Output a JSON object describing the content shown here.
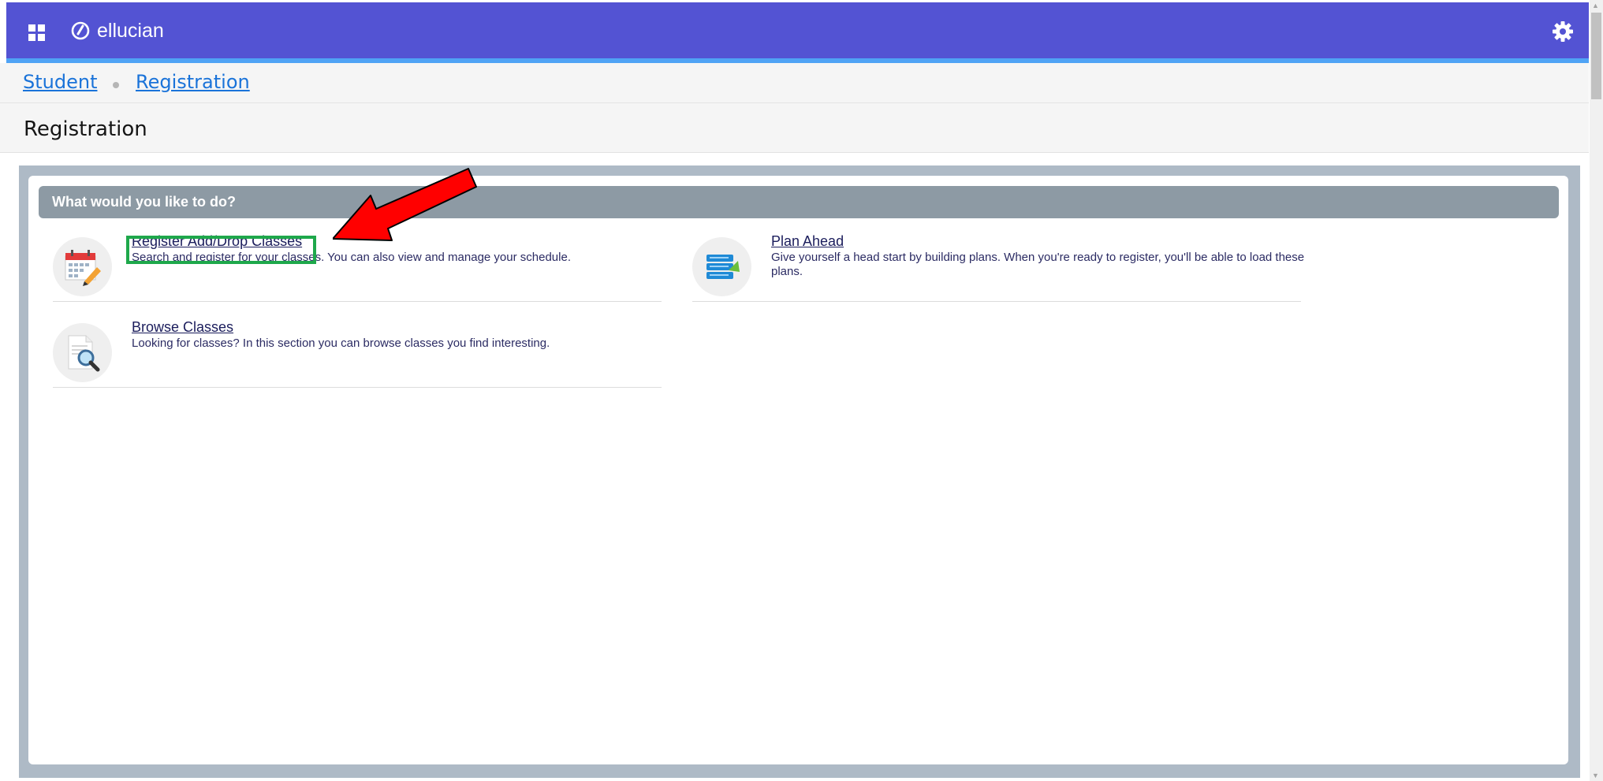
{
  "header": {
    "brand": "ellucian",
    "colors": {
      "bar": "#5353d3",
      "accent_line": "#4fa3f5"
    },
    "icons": [
      "apps-grid-icon",
      "ellucian-logo-icon",
      "gear-icon"
    ]
  },
  "breadcrumb": {
    "items": [
      {
        "label": "Student"
      },
      {
        "label": "Registration"
      }
    ]
  },
  "page": {
    "title": "Registration"
  },
  "panel": {
    "heading": "What would you like to do?",
    "actions": [
      {
        "title": "Register Add/Drop Classes",
        "description": "Search and register for your classes. You can also view and manage your schedule.",
        "icon": "calendar-pencil-icon"
      },
      {
        "title": "Plan Ahead",
        "description": "Give yourself a head start by building plans. When you're ready to register, you'll be able to load these plans.",
        "icon": "plan-list-icon"
      },
      {
        "title": "Browse Classes",
        "description": "Looking for classes? In this section you can browse classes you find interesting.",
        "icon": "document-magnifier-icon"
      }
    ]
  },
  "annotations": {
    "highlight_color": "#1ea84b",
    "arrow_color": "#ff0000"
  }
}
